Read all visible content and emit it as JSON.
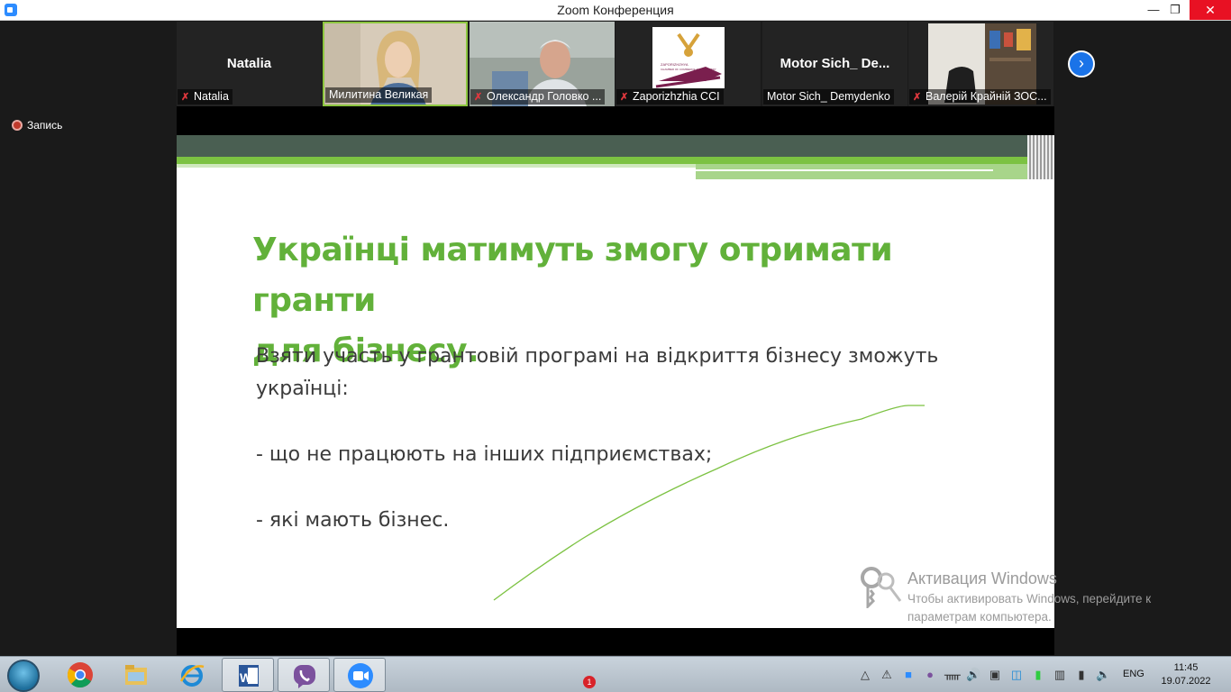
{
  "window": {
    "title": "Zoom Конференция",
    "minimize_icon": "minimize-icon",
    "maximize_icon": "restore-icon",
    "close_icon": "close-icon"
  },
  "participants": [
    {
      "big_name": "Natalia",
      "label": "Natalia",
      "muted": true,
      "video": false
    },
    {
      "big_name": "",
      "label": "Милитина Великая",
      "muted": false,
      "video": true,
      "active": true
    },
    {
      "big_name": "",
      "label": "Олександр Головко ...",
      "muted": true,
      "video": true
    },
    {
      "big_name": "",
      "label": "Zaporizhzhia CCI",
      "muted": true,
      "video": true,
      "logo_text": "ZAPORIZHZHYA CHAMBER OF COMMERCE AND INDUSTRY"
    },
    {
      "big_name": "Motor Sich_ De...",
      "label": "Motor Sich_ Demydenko",
      "muted": false,
      "video": false
    },
    {
      "big_name": "",
      "label": "Валерій Крайній ЗОС...",
      "muted": true,
      "video": true
    }
  ],
  "recording": {
    "label": "Запись"
  },
  "slide": {
    "title_line1": "Українці матимуть змогу отримати гранти",
    "title_line2": "для бізнесу.",
    "body_line1": "Взяти участь у грантовій програмі на відкриття бізнесу зможуть",
    "body_line2": "українці:",
    "bullet1": "- що не працюють на інших підприємствах;",
    "bullet2": "- які мають бізнес.",
    "colors": {
      "title": "#62b13a",
      "header_bar": "#4a5f52",
      "accent": "#7cc242"
    }
  },
  "activation": {
    "title": "Активация Windows",
    "line1": "Чтобы активировать Windows, перейдите к",
    "line2": "параметрам компьютера."
  },
  "taskbar": {
    "apps": [
      "start-orb-icon",
      "chrome-icon",
      "file-explorer-icon",
      "internet-explorer-icon",
      "word-icon",
      "viber-icon",
      "zoom-icon"
    ],
    "viber_badge": "1",
    "language": "ENG",
    "time": "11:45",
    "date": "19.07.2022"
  }
}
